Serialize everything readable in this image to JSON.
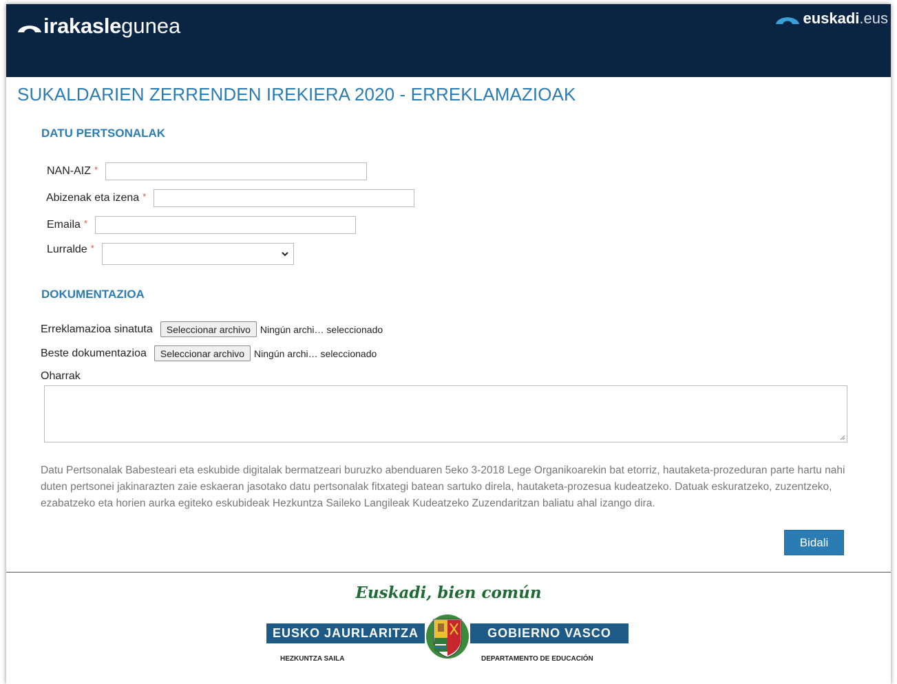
{
  "header": {
    "brand_bold": "irakasle",
    "brand_light": "gunea",
    "portal_bold": "euskadi",
    "portal_light": ".eus"
  },
  "page_title": "SUKALDARIEN ZERRENDEN IREKIERA 2020 - ERREKLAMAZIOAK",
  "personal": {
    "title": "DATU PERTSONALAK",
    "nan_label": "NAN-AIZ",
    "nan_value": "",
    "name_label": "Abizenak eta izena",
    "name_value": "",
    "email_label": "Emaila",
    "email_value": "",
    "region_label": "Lurralde",
    "region_value": "",
    "required_mark": "*"
  },
  "docs": {
    "title": "DOKUMENTAZIOA",
    "signed_label": "Erreklamazioa sinatuta",
    "other_label": "Beste dokumentazioa",
    "file_button": "Seleccionar archivo",
    "file_status": "Ningún archi… seleccionado",
    "notes_label": "Oharrak",
    "notes_value": ""
  },
  "legal_text": "Datu Pertsonalak Babesteari eta eskubide digitalak bermatzeari buruzko abenduaren 5eko 3-2018 Lege Organikoarekin bat etorriz, hautaketa-prozeduran parte hartu nahi duten pertsonei jakinarazten zaie eskaeran jasotako datu pertsonalak fitxategi batean sartuko direla, hautaketa-prozesua kudeatzeko. Datuak eskuratzeko, zuzentzeko, ezabatzeko eta horien aurka egiteko eskubideak Hezkuntza Saileko Langileak Kudeatzeko Zuzendaritzan baliatu ahal izango dira.",
  "submit_label": "Bidali",
  "footer": {
    "slogan": "Euskadi, bien común",
    "gov_eu": "EUSKO JAURLARITZA",
    "gov_es": "GOBIERNO VASCO",
    "dept_eu": "HEZKUNTZA SAILA",
    "dept_es": "DEPARTAMENTO DE EDUCACIÓN"
  },
  "colors": {
    "header_bg": "#0a2544",
    "accent": "#2b7cb3",
    "required": "#d9534f",
    "slogan": "#1f6b35",
    "gov_bar": "#1d5a86"
  }
}
